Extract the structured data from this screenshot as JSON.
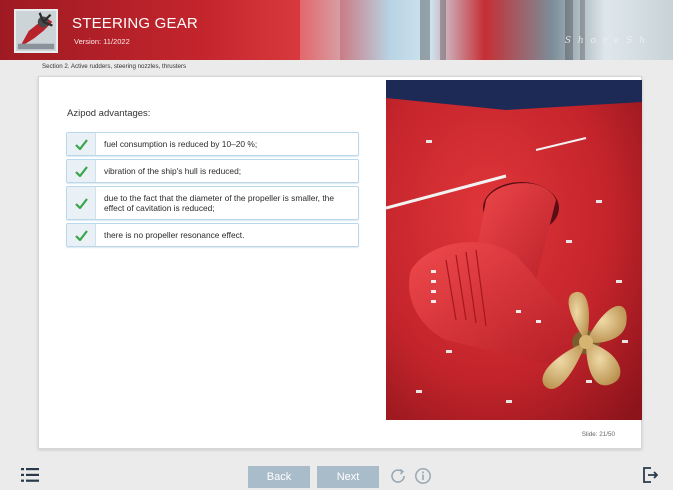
{
  "header": {
    "title": "STEERING GEAR",
    "version": "Version: 11/2022",
    "brand": "S h o r e  S h"
  },
  "section": "Section 2. Active rudders, steering nozzles, thrusters",
  "content": {
    "intro": "Azipod advantages:",
    "items": [
      "fuel consumption is reduced by 10–20 %;",
      "vibration of the ship's hull is reduced;",
      "due to the fact that the diameter of the propeller is smaller, the effect of cavitation is reduced;",
      "there is no propeller resonance effect."
    ],
    "slide": "Slide: 21/50"
  },
  "footer": {
    "back_label": "Back",
    "next_label": "Next"
  },
  "icons": {
    "check": "check-icon",
    "menu": "list-menu-icon",
    "reload": "reload-icon",
    "info": "info-icon",
    "exit": "exit-icon"
  },
  "colors": {
    "accent_red": "#c62e34",
    "check_green": "#3aa54b",
    "button": "#a9bcc9",
    "item_border": "#b9d8ec"
  }
}
